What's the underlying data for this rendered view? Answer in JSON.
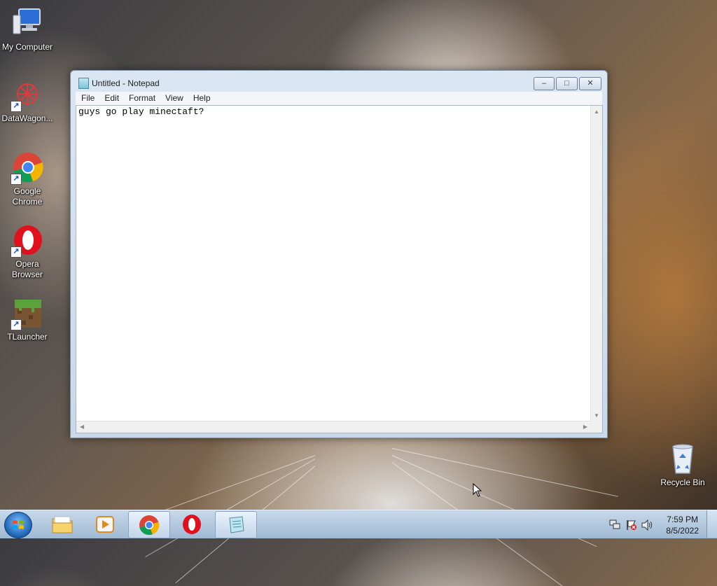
{
  "desktop": {
    "icons": [
      {
        "label": "My Computer",
        "icon": "computer-icon"
      },
      {
        "label": "DataWagon...",
        "icon": "datawagon-icon"
      },
      {
        "label": "Google Chrome",
        "icon": "chrome-icon"
      },
      {
        "label": "Opera Browser",
        "icon": "opera-icon"
      },
      {
        "label": "TLauncher",
        "icon": "minecraft-grass-icon"
      },
      {
        "label": "Recycle Bin",
        "icon": "recycle-bin-icon"
      }
    ]
  },
  "notepad": {
    "title": "Untitled - Notepad",
    "menu": [
      "File",
      "Edit",
      "Format",
      "View",
      "Help"
    ],
    "content": "guys go play minectaft?",
    "controls": {
      "minimize": "–",
      "maximize": "□",
      "close": "✕"
    }
  },
  "taskbar": {
    "buttons": [
      {
        "name": "start",
        "icon": "windows-start-icon"
      },
      {
        "name": "explorer",
        "icon": "folder-icon"
      },
      {
        "name": "media-player",
        "icon": "media-player-icon"
      },
      {
        "name": "chrome",
        "icon": "chrome-icon"
      },
      {
        "name": "opera",
        "icon": "opera-icon"
      },
      {
        "name": "notepad",
        "icon": "notepad-icon"
      }
    ],
    "clock": {
      "time": "7:59 PM",
      "date": "8/5/2022"
    }
  },
  "colors": {
    "taskbar": "#b3cbe2",
    "window_frame": "#d3e0ef",
    "accent": "#1b5fb0"
  }
}
